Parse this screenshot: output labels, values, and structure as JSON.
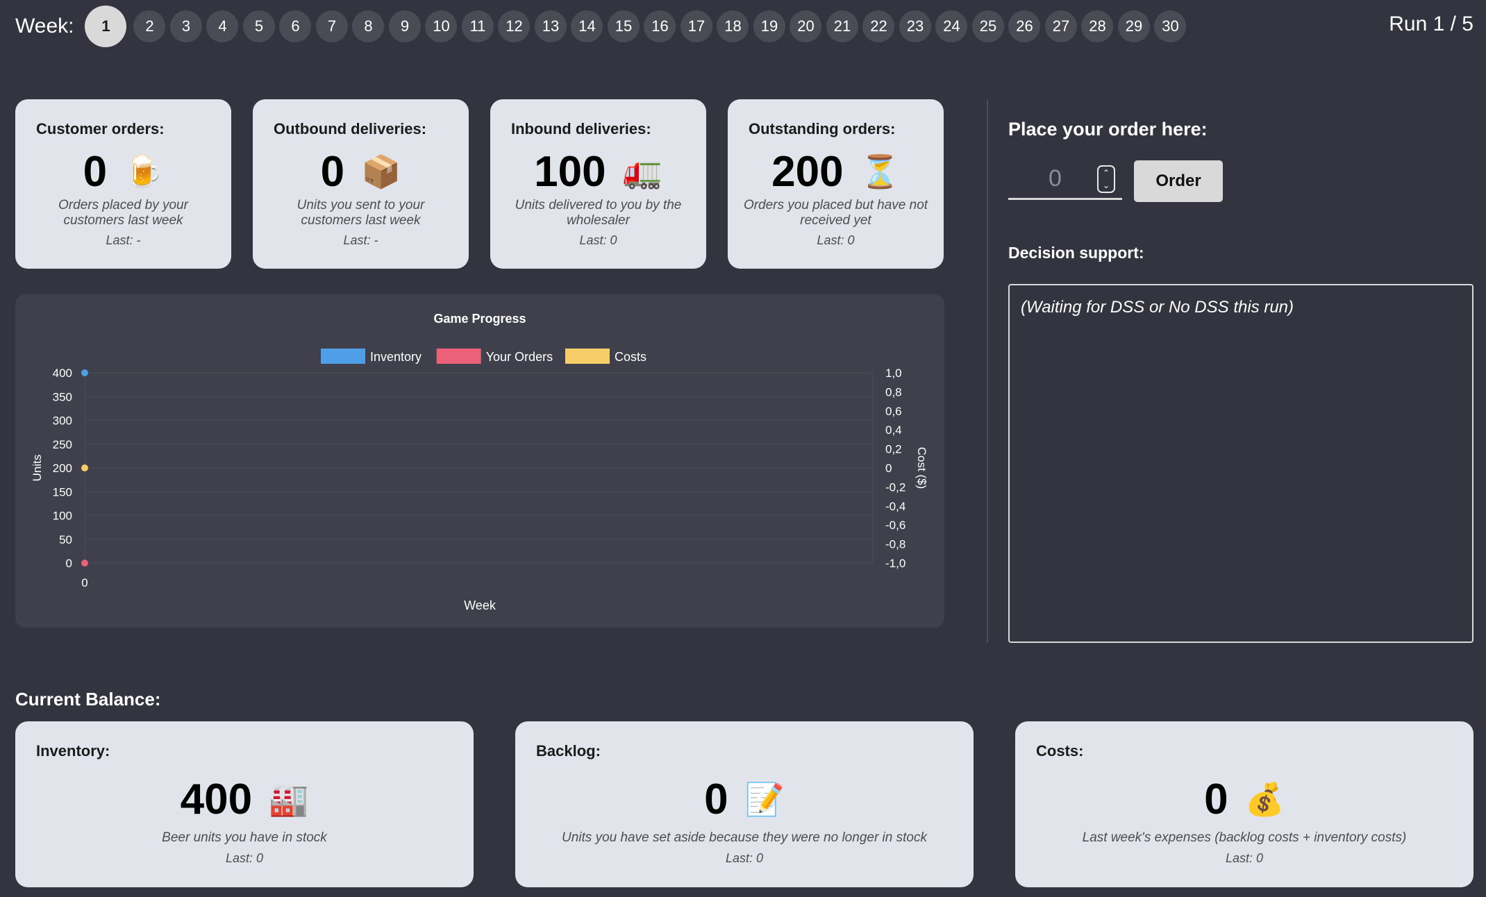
{
  "header": {
    "week_label": "Week:",
    "weeks": [
      "1",
      "2",
      "3",
      "4",
      "5",
      "6",
      "7",
      "8",
      "9",
      "10",
      "11",
      "12",
      "13",
      "14",
      "15",
      "16",
      "17",
      "18",
      "19",
      "20",
      "21",
      "22",
      "23",
      "24",
      "25",
      "26",
      "27",
      "28",
      "29",
      "30"
    ],
    "active_week": "1",
    "run_label": "Run 1 / 5"
  },
  "metrics": [
    {
      "title": "Customer orders:",
      "value": "0",
      "icon": "beer-mug-icon",
      "glyph": "🍺",
      "desc": "Orders placed by your customers last week",
      "last": "Last: -"
    },
    {
      "title": "Outbound deliveries:",
      "value": "0",
      "icon": "package-icon",
      "glyph": "📦",
      "desc": "Units you sent to your customers last week",
      "last": "Last: -"
    },
    {
      "title": "Inbound deliveries:",
      "value": "100",
      "icon": "truck-icon",
      "glyph": "🚛",
      "desc": "Units delivered to you by the wholesaler",
      "last": "Last: 0"
    },
    {
      "title": "Outstanding orders:",
      "value": "200",
      "icon": "hourglass-icon",
      "glyph": "⏳",
      "desc": "Orders you placed but have not received yet",
      "last": "Last: 0"
    }
  ],
  "chart_data": {
    "type": "line",
    "title": "Game Progress",
    "xlabel": "Week",
    "ylabel": "Units",
    "y2label": "Cost ($)",
    "x": [
      0
    ],
    "x_ticks": [
      "0"
    ],
    "ylim": [
      0,
      400
    ],
    "y_ticks": [
      "0",
      "50",
      "100",
      "150",
      "200",
      "250",
      "300",
      "350",
      "400"
    ],
    "y2lim": [
      -1.0,
      1.0
    ],
    "y2_ticks": [
      "-1,0",
      "-0,8",
      "-0,6",
      "-0,4",
      "-0,2",
      "0",
      "0,2",
      "0,4",
      "0,6",
      "0,8",
      "1,0"
    ],
    "legend_position": "top",
    "series": [
      {
        "name": "Inventory",
        "values": [
          400
        ],
        "color": "#4e9fe8",
        "axis": "left"
      },
      {
        "name": "Your Orders",
        "values": [
          0
        ],
        "color": "#eb6179",
        "axis": "left"
      },
      {
        "name": "Costs",
        "values": [
          200
        ],
        "color": "#f7cd6a",
        "axis": "left"
      }
    ],
    "grid": true
  },
  "order": {
    "title": "Place your order here:",
    "input_value": "0",
    "button_label": "Order"
  },
  "dss": {
    "title": "Decision support:",
    "text": "(Waiting for DSS or No DSS this run)"
  },
  "balance": {
    "title": "Current Balance:",
    "cards": [
      {
        "title": "Inventory:",
        "value": "400",
        "icon": "factory-icon",
        "glyph": "🏭",
        "desc": "Beer units you have in stock",
        "last": "Last: 0"
      },
      {
        "title": "Backlog:",
        "value": "0",
        "icon": "memo-icon",
        "glyph": "📝",
        "desc": "Units you have set aside because they were no longer in stock",
        "last": "Last: 0"
      },
      {
        "title": "Costs:",
        "value": "0",
        "icon": "money-bag-icon",
        "glyph": "💰",
        "desc": "Last week's expenses (backlog costs + inventory costs)",
        "last": "Last: 0"
      }
    ]
  }
}
